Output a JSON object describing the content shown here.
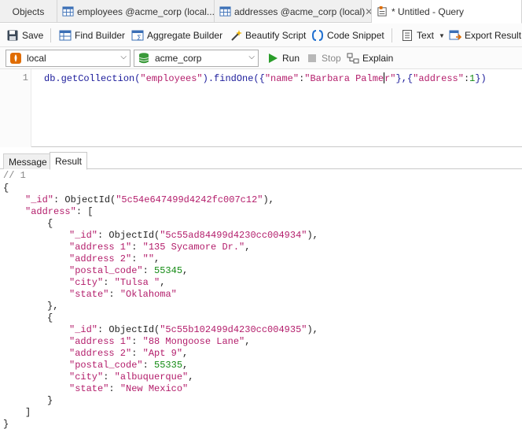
{
  "tabs": [
    {
      "label": "Objects"
    },
    {
      "label": "employees @acme_corp (local..."
    },
    {
      "label": "addresses @acme_corp (local)"
    },
    {
      "label": "* Untitled - Query"
    }
  ],
  "toolbar": {
    "save": "Save",
    "find_builder": "Find Builder",
    "aggregate_builder": "Aggregate Builder",
    "beautify": "Beautify Script",
    "snippet": "Code Snippet",
    "text": "Text",
    "export": "Export Result"
  },
  "connection": {
    "server": "local",
    "database": "acme_corp",
    "run": "Run",
    "stop": "Stop",
    "explain": "Explain"
  },
  "editor": {
    "line_number": "1",
    "query": {
      "fn": "db.getCollection(",
      "collection": "\"employees\"",
      "mid": ").findOne({",
      "k1": "\"name\"",
      "colon": ":",
      "v1a": "\"Barbara Palme",
      "v1b": "r\"",
      "mid2": "},{",
      "k2": "\"address\"",
      "colon2": ":",
      "v2": "1",
      "end": "})"
    }
  },
  "result_tabs": {
    "message": "Message",
    "result": "Result"
  },
  "output": {
    "comment": "// 1",
    "root_id": "\"5c54e647499d4242fc007c12\"",
    "addresses": [
      {
        "id": "\"5c55ad84499d4230cc004934\"",
        "address1": "\"135 Sycamore Dr.\"",
        "address2": "\"\"",
        "postal_code": "55345",
        "city": "\"Tulsa \"",
        "state": "\"Oklahoma\""
      },
      {
        "id": "\"5c55b102499d4230cc004935\"",
        "address1": "\"88 Mongoose Lane\"",
        "address2": "\"Apt 9\"",
        "postal_code": "55335",
        "city": "\"albuquerque\"",
        "state": "\"New Mexico\""
      }
    ],
    "keys": {
      "id": "\"_id\"",
      "address": "\"address\"",
      "address1": "\"address 1\"",
      "address2": "\"address 2\"",
      "postal_code": "\"postal_code\"",
      "city": "\"city\"",
      "state": "\"state\""
    },
    "objectid": "ObjectId("
  },
  "colors": {
    "string": "#b31d6b",
    "number": "#128a12",
    "keyword": "#1a1a9a",
    "run_green": "#2a9d2a",
    "mongo_green": "#3a9a3a",
    "mongo_orange": "#e06c00"
  },
  "icons": {
    "save": "floppy-icon",
    "find": "find-builder-icon",
    "aggregate": "aggregate-builder-icon",
    "beautify": "beautify-wand-icon",
    "snippet": "code-snippet-icon",
    "text": "text-doc-icon",
    "export": "export-icon",
    "run": "play-icon",
    "stop": "stop-icon",
    "explain": "explain-icon"
  }
}
